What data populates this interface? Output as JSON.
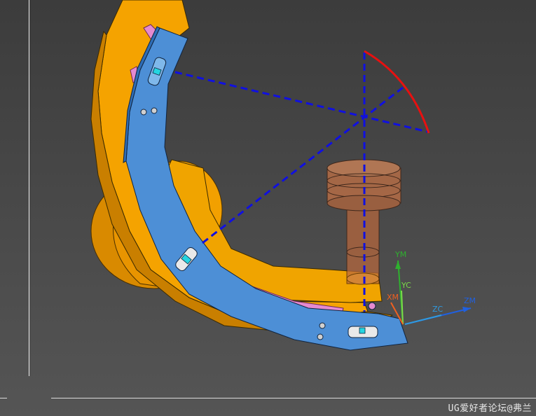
{
  "viewport": {
    "background_top": "#3c3c3c",
    "background_bottom": "#555555"
  },
  "colors": {
    "bracket_orange": "#f5a000",
    "bracket_orange_dark": "#c97d00",
    "plate_blue": "#4e8fd6",
    "plate_blue_dark": "#2f6db5",
    "tool_body": "#c96a3c",
    "sweep_line": "#1010e0",
    "arc_red": "#e81010",
    "axis_green": "#2fb02f",
    "axis_blue": "#2060e0",
    "axis_orange": "#f06020",
    "accent_pink": "#e58ad0",
    "accent_cyan": "#25d5e0"
  },
  "csys": {
    "labels": {
      "ym": "YM",
      "yc": "YC",
      "xm": "XM",
      "zc": "ZC",
      "zm": "ZM"
    }
  },
  "watermark": {
    "text": "UG爱好者论坛@弗兰"
  }
}
